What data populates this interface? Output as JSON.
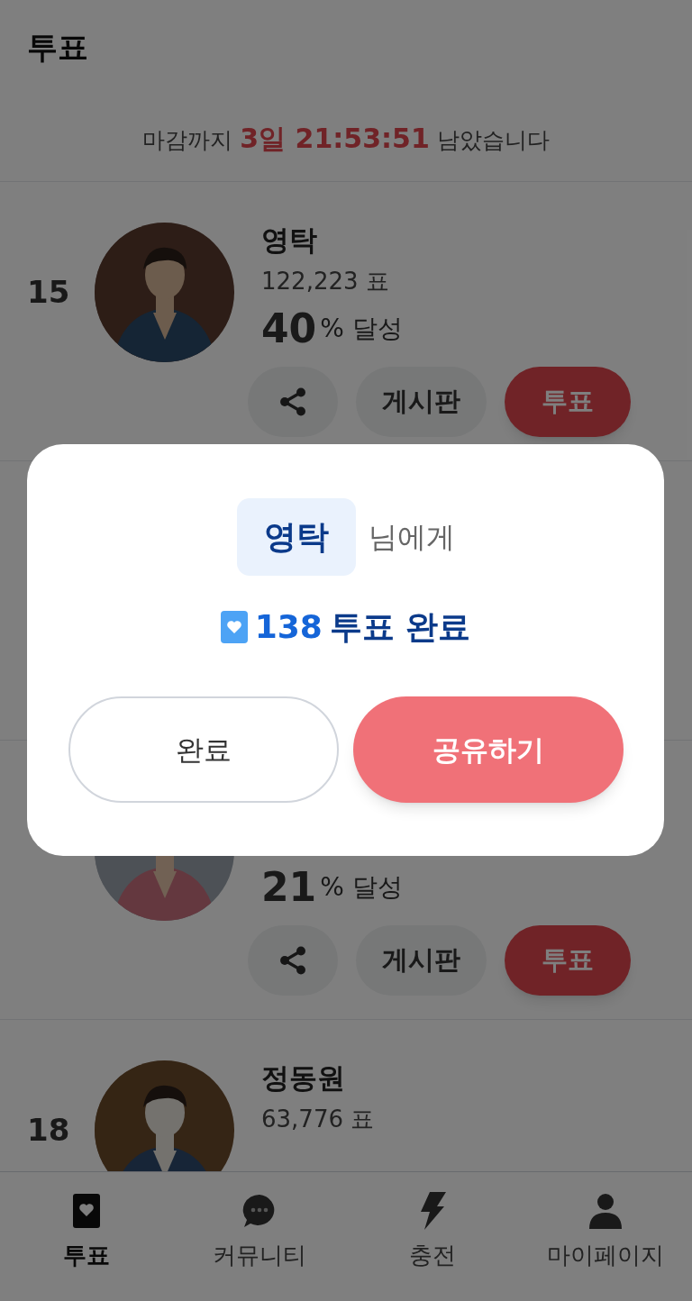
{
  "header": {
    "title": "투표"
  },
  "countdown": {
    "prefix": "마감까지",
    "remaining": "3일 21:53:51",
    "suffix": "남았습니다"
  },
  "candidates": [
    {
      "rank": "15",
      "name": "영탁",
      "votes": "122,223 표",
      "percent": "40",
      "percent_label": "% 달성",
      "board_label": "게시판",
      "vote_label": "투표"
    },
    {
      "percent": "21",
      "percent_label": "% 달성",
      "board_label": "게시판",
      "vote_label": "투표"
    },
    {
      "rank": "18",
      "name": "정동원",
      "votes": "63,776 표"
    }
  ],
  "bottom_nav": [
    {
      "label": "투표",
      "selected": true
    },
    {
      "label": "커뮤니티",
      "selected": false
    },
    {
      "label": "충전",
      "selected": false
    },
    {
      "label": "마이페이지",
      "selected": false
    }
  ],
  "dialog": {
    "recipient": "영탁",
    "recipient_suffix": "님에게",
    "count": "138",
    "result": "투표 완료",
    "buttons": [
      {
        "label": "완료",
        "kind": "secondary"
      },
      {
        "label": "공유하기",
        "kind": "primary"
      }
    ]
  }
}
